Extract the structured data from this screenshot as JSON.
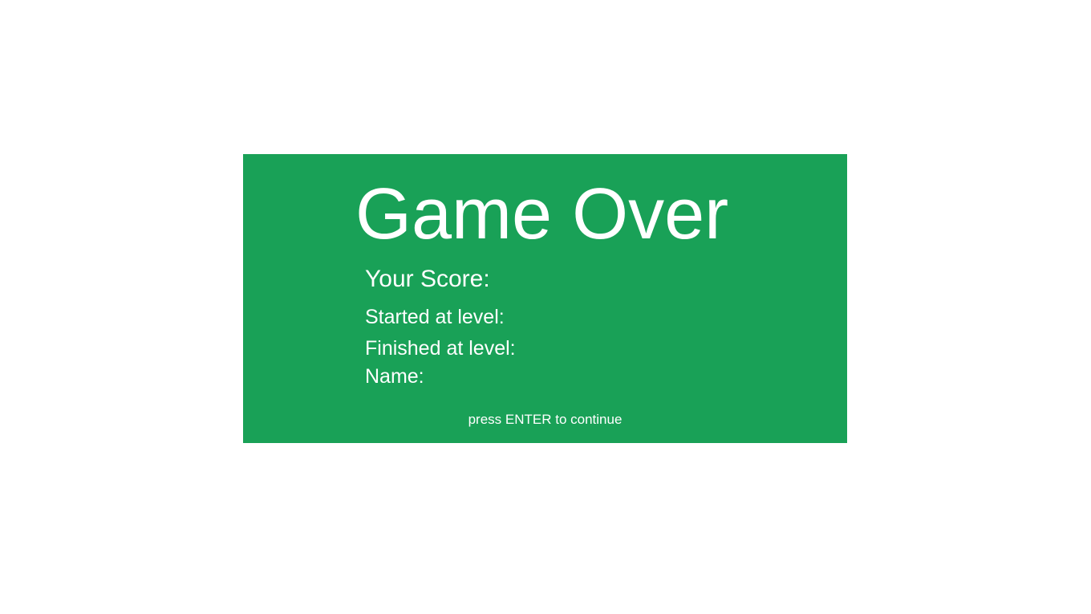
{
  "game_over": {
    "title": "Game Over",
    "score_label": "Your Score:",
    "started_label": "Started at level:",
    "finished_label": "Finished at level:",
    "name_label": "Name:",
    "hint": "press ENTER to continue"
  },
  "colors": {
    "panel_background": "#19a157",
    "text": "#ffffff",
    "page_background": "#ffffff"
  }
}
